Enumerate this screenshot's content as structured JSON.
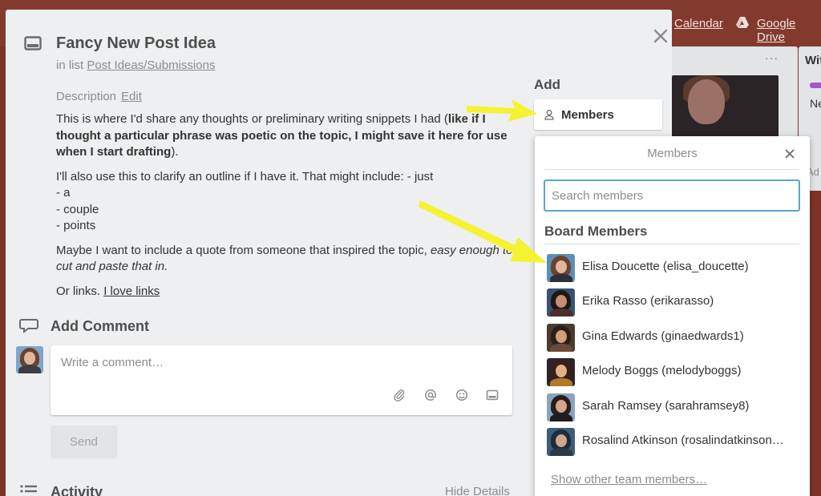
{
  "board": {
    "calendar_label": "Calendar",
    "drive_label": "Google Drive",
    "list2_title": "Wit",
    "list2_card_text": "Ne",
    "list2_add_text": "Ad"
  },
  "card": {
    "title": "Fancy New Post Idea",
    "in_list_prefix": "in list",
    "list_name": "Post Ideas/Submissions",
    "description_label": "Description",
    "edit_label": "Edit",
    "description": {
      "p1_start": "This is where I'd share any thoughts or preliminary writing snippets I had (",
      "p1_bold": "like if I thought a particular phrase was poetic on the topic, I might save it here for use when I start drafting",
      "p1_end": ").",
      "p2_line1": "I'll also use this to clarify an outline if I have it. That might include: - just",
      "p2_line2": "- a",
      "p2_line3": "- couple",
      "p2_line4": "- points",
      "p3_start": "Maybe I want to include a quote from someone that inspired the topic, ",
      "p3_italic": "easy enough to cut and paste that in.",
      "p4_start": "Or links. ",
      "p4_link": "I love links"
    },
    "add_comment_label": "Add Comment",
    "comment_placeholder": "Write a comment…",
    "send_label": "Send",
    "activity_label": "Activity",
    "hide_details_label": "Hide Details"
  },
  "sidebar": {
    "add_label": "Add",
    "members_button_label": "Members"
  },
  "members_popover": {
    "title": "Members",
    "search_placeholder": "Search members",
    "board_members_label": "Board Members",
    "members": [
      {
        "name": "Elisa Doucette (elisa_doucette)"
      },
      {
        "name": "Erika Rasso (erikarasso)"
      },
      {
        "name": "Gina Edwards (ginaedwards1)"
      },
      {
        "name": "Melody Boggs (melodyboggs)"
      },
      {
        "name": "Sarah Ramsey (sarahramsey8)"
      },
      {
        "name": "Rosalind Atkinson (rosalindatkinson…"
      }
    ],
    "show_other_label": "Show other team members…"
  },
  "colors": {
    "board_bg": "#7e3328",
    "modal_bg": "#edeff0",
    "accent_blue": "#5ba4cf",
    "arrow_yellow": "#f5f232"
  },
  "icons": {
    "close": "close-icon",
    "card": "card-icon",
    "comment": "comment-icon",
    "attachment": "paperclip-icon",
    "mention": "at-icon",
    "emoji": "emoji-icon",
    "card_attach": "card-attach-icon",
    "activity": "list-icon",
    "member": "person-icon"
  }
}
